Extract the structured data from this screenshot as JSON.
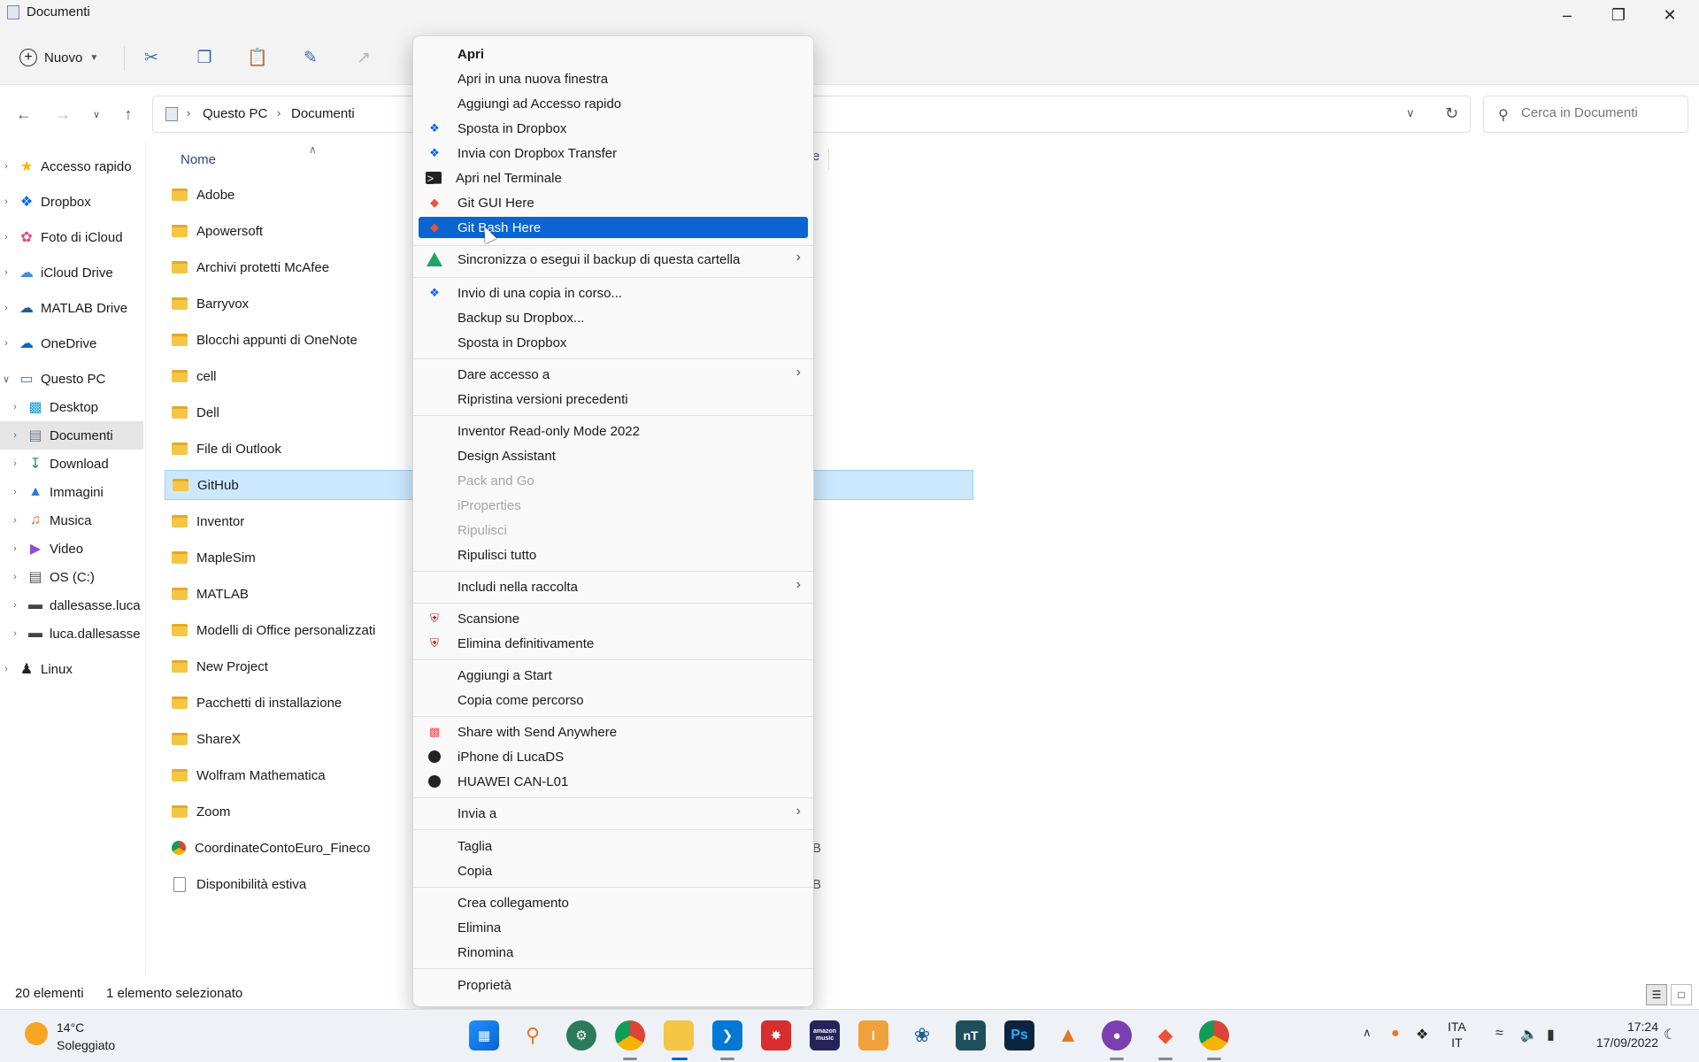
{
  "window": {
    "title": "Documenti",
    "minimize_icon": "minimize-icon",
    "restore_icon": "restore-icon",
    "close_icon": "close-icon"
  },
  "toolbar": {
    "new_label": "Nuovo"
  },
  "address": {
    "crumbs": [
      "Questo PC",
      "Documenti"
    ],
    "search_placeholder": "Cerca in Documenti"
  },
  "sidebar": {
    "items": [
      {
        "label": "Accesso rapido",
        "icon": "star-icon"
      },
      {
        "label": "Dropbox",
        "icon": "dropbox-icon"
      },
      {
        "label": "Foto di iCloud",
        "icon": "icloud-photos-icon"
      },
      {
        "label": "iCloud Drive",
        "icon": "icloud-drive-icon"
      },
      {
        "label": "MATLAB Drive",
        "icon": "matlab-drive-icon"
      },
      {
        "label": "OneDrive",
        "icon": "onedrive-icon"
      },
      {
        "label": "Questo PC",
        "icon": "computer-icon"
      },
      {
        "label": "Desktop",
        "icon": "desktop-icon"
      },
      {
        "label": "Documenti",
        "icon": "documents-icon"
      },
      {
        "label": "Download",
        "icon": "download-icon"
      },
      {
        "label": "Immagini",
        "icon": "pictures-icon"
      },
      {
        "label": "Musica",
        "icon": "music-icon"
      },
      {
        "label": "Video",
        "icon": "video-icon"
      },
      {
        "label": "OS (C:)",
        "icon": "drive-icon"
      },
      {
        "label": "dallesasse.luca",
        "icon": "network-drive-icon"
      },
      {
        "label": "luca.dallesasse",
        "icon": "network-drive-icon"
      },
      {
        "label": "Linux",
        "icon": "linux-icon"
      }
    ]
  },
  "files": {
    "column_name": "Nome",
    "items": [
      "Adobe",
      "Apowersoft",
      "Archivi protetti McAfee",
      "Barryvox",
      "Blocchi appunti di OneNote",
      "cell",
      "Dell",
      "File di Outlook",
      "GitHub",
      "Inventor",
      "MapleSim",
      "MATLAB",
      "Modelli di Office personalizzati",
      "New Project",
      "Pacchetti di installazione",
      "ShareX",
      "Wolfram Mathematica",
      "Zoom",
      "CoordinateContoEuro_Fineco",
      "Disponibilità estiva"
    ],
    "partial_header": "e",
    "partial_size_1": "B",
    "partial_size_2": "B"
  },
  "status": {
    "count": "20 elementi",
    "selected": "1 elemento selezionato"
  },
  "context_menu": {
    "items": [
      "Apri",
      "Apri in una nuova finestra",
      "Aggiungi ad Accesso rapido",
      "Sposta in Dropbox",
      "Invia con Dropbox Transfer",
      "Apri nel Terminale",
      "Git GUI Here",
      "Git Bash Here",
      "Sincronizza o esegui il backup di questa cartella",
      "Invio di una copia in corso...",
      "Backup su Dropbox...",
      "Sposta in Dropbox",
      "Dare accesso a",
      "Ripristina versioni precedenti",
      "Inventor Read-only Mode 2022",
      "Design Assistant",
      "Pack and Go",
      "iProperties",
      "Ripulisci",
      "Ripulisci tutto",
      "Includi nella raccolta",
      "Scansione",
      "Elimina definitivamente",
      "Aggiungi a Start",
      "Copia come percorso",
      "Share with Send Anywhere",
      "iPhone di LucaDS",
      "HUAWEI CAN-L01",
      "Invia a",
      "Taglia",
      "Copia",
      "Crea collegamento",
      "Elimina",
      "Rinomina",
      "Proprietà"
    ]
  },
  "taskbar": {
    "temperature": "14°C",
    "weather": "Soleggiato",
    "lang1": "ITA",
    "lang2": "IT",
    "time": "17:24",
    "date": "17/09/2022",
    "ps_label": "Ps",
    "nt_label": "nT",
    "music_label": "amazon music"
  },
  "colors": {
    "accent": "#0a64d2",
    "selection": "#cce8ff",
    "folder": "#f5c644"
  }
}
